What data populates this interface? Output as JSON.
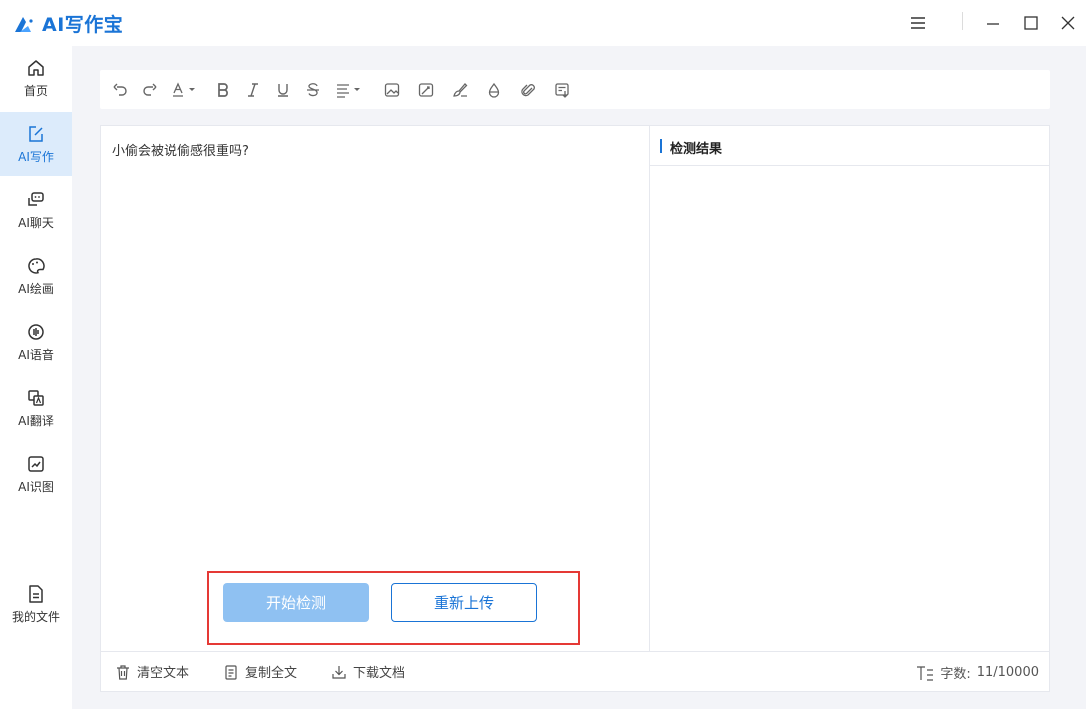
{
  "app": {
    "title": "AI写作宝",
    "brand_color": "#1a74d6"
  },
  "window_controls": [
    "menu-icon",
    "minimize-icon",
    "maximize-icon",
    "close-icon"
  ],
  "sidebar": {
    "items": [
      {
        "label": "首页",
        "icon": "home-icon",
        "active": false
      },
      {
        "label": "AI写作",
        "icon": "edit-icon",
        "active": true
      },
      {
        "label": "AI聊天",
        "icon": "chat-icon",
        "active": false
      },
      {
        "label": "AI绘画",
        "icon": "palette-icon",
        "active": false
      },
      {
        "label": "AI语音",
        "icon": "voice-icon",
        "active": false
      },
      {
        "label": "AI翻译",
        "icon": "translate-icon",
        "active": false
      },
      {
        "label": "AI识图",
        "icon": "image-recognition-icon",
        "active": false
      }
    ],
    "bottom_item": {
      "label": "我的文件",
      "icon": "file-icon"
    }
  },
  "toolbar": {
    "items": [
      "undo-icon",
      "redo-icon",
      "font-color-icon",
      "bold-icon",
      "italic-icon",
      "underline-icon",
      "strikethrough-icon",
      "align-icon",
      "image-icon",
      "image-edit-icon",
      "format-brush-icon",
      "drop-icon",
      "attachment-icon",
      "clear-format-icon"
    ]
  },
  "editor": {
    "content": "小偷会被说偷感很重吗?"
  },
  "result": {
    "title": "检测结果"
  },
  "actions": {
    "start_label": "开始检测",
    "reupload_label": "重新上传"
  },
  "bottom_bar": {
    "clear_label": "清空文本",
    "copy_label": "复制全文",
    "download_label": "下载文档",
    "count_label": "字数:",
    "count_value": "11/10000"
  }
}
